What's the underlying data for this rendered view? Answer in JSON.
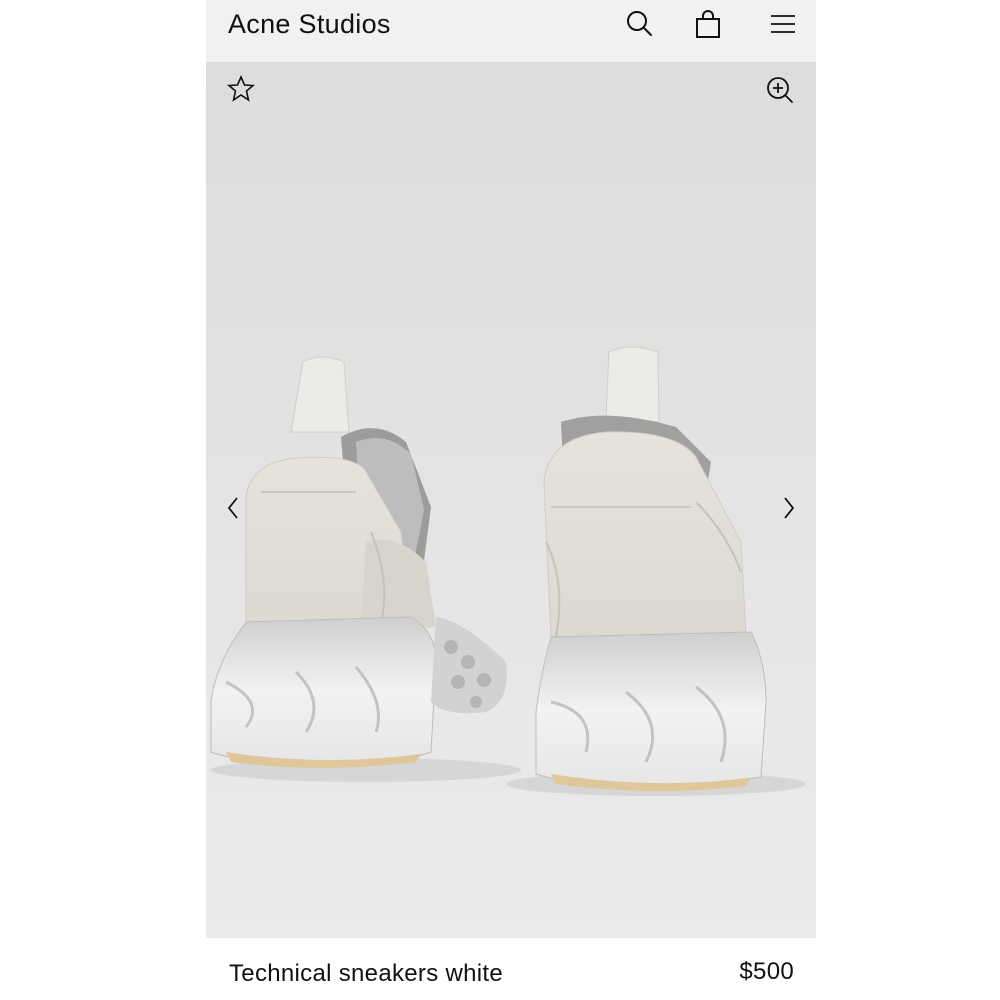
{
  "header": {
    "brand": "Acne Studios",
    "icons": [
      "search-icon",
      "shopping-bag-icon",
      "menu-icon"
    ]
  },
  "gallery": {
    "image": "product-photo-sneakers-rear-view",
    "icons": [
      "favorite-star-icon",
      "zoom-in-icon",
      "chevron-left-icon",
      "chevron-right-icon"
    ]
  },
  "product": {
    "name": "Technical sneakers white",
    "price": "$500"
  },
  "colors": {
    "header_bg": "#f1f1f1",
    "gallery_bg": "#e3e3e3",
    "text": "#111111"
  }
}
